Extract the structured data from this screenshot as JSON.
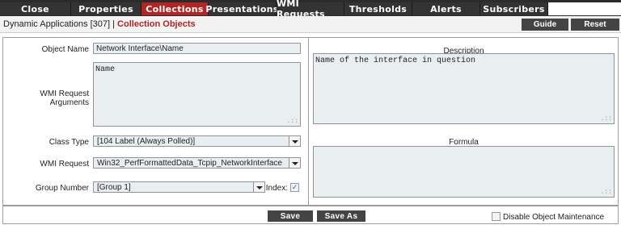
{
  "tabs": [
    {
      "label": "Close"
    },
    {
      "label": "Properties"
    },
    {
      "label": "Collections"
    },
    {
      "label": "Presentations"
    },
    {
      "label": "WMI Requests"
    },
    {
      "label": "Thresholds"
    },
    {
      "label": "Alerts"
    },
    {
      "label": "Subscribers"
    }
  ],
  "header": {
    "breadcrumb_prefix": "Dynamic Applications [307] |",
    "breadcrumb_section": "Collection Objects",
    "guide_label": "Guide",
    "reset_label": "Reset"
  },
  "form": {
    "object_name_label": "Object Name",
    "object_name_value": "Network Interface\\Name",
    "wmi_args_label": "WMI Request Arguments",
    "wmi_args_value": "Name",
    "class_type_label": "Class Type",
    "class_type_value": "[104 Label (Always Polled)]",
    "wmi_request_label": "WMI Request",
    "wmi_request_value": "Win32_PerfFormattedData_Tcpip_NetworkInterface",
    "group_number_label": "Group Number",
    "group_number_value": "[Group 1]",
    "index_label": "Index:",
    "index_checked": true,
    "description_title": "Description",
    "description_value": "Name of the interface in question",
    "formula_title": "Formula",
    "formula_value": ""
  },
  "footer": {
    "save_label": "Save",
    "save_as_label": "Save As",
    "disable_label": "Disable Object Maintenance",
    "disable_checked": false
  }
}
